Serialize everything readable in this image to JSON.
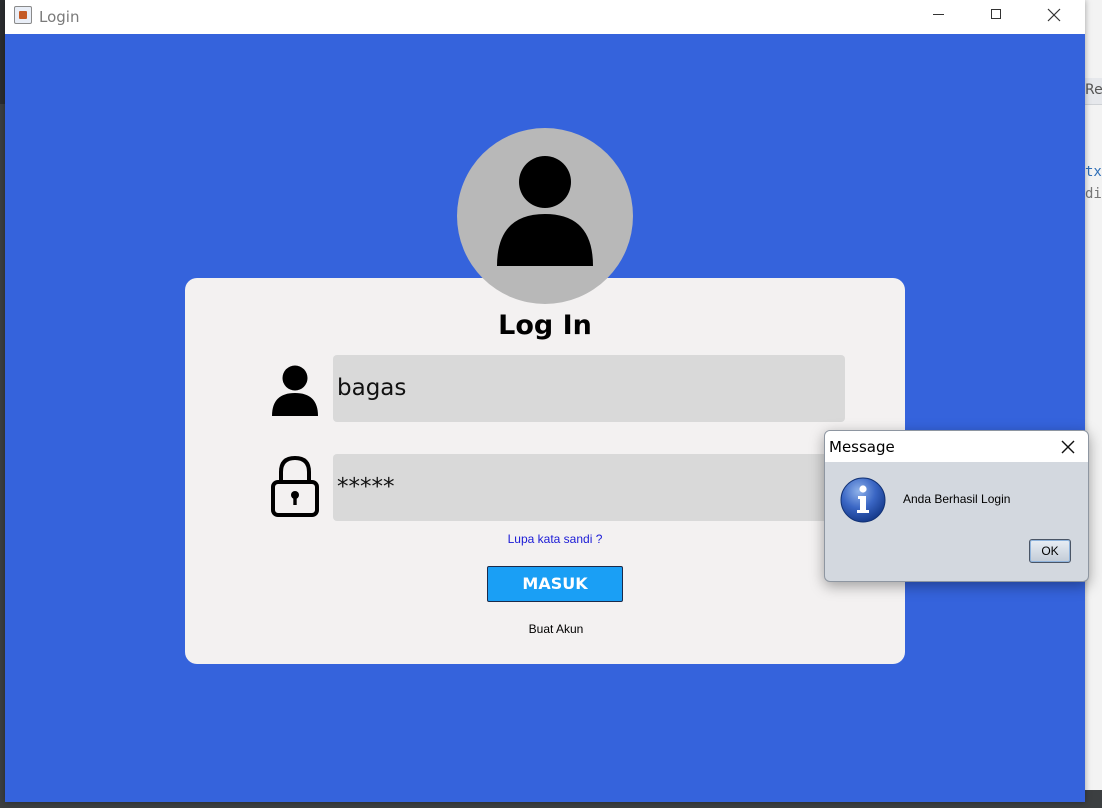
{
  "window": {
    "title": "Login",
    "background_color": "#3563dc",
    "controls": [
      "minimize-icon",
      "maximize-icon",
      "close-icon"
    ]
  },
  "login_card": {
    "heading": "Log In",
    "username_value": "bagas",
    "password_value": "*****",
    "forgot_password_link": "Lupa kata sandi ?",
    "submit_button": "MASUK",
    "create_account_link": "Buat Akun",
    "card_color": "#f3f1f1",
    "field_color": "#d9d9d9",
    "button_color": "#1a9ff5",
    "link_color": "#1a1ad6",
    "avatar_icon": "user-icon",
    "username_icon": "user-icon",
    "password_icon": "lock-icon"
  },
  "message_dialog": {
    "title": "Message",
    "message": "Anda Berhasil Login",
    "ok_label": "OK",
    "icon": "info-icon"
  },
  "background_ide": {
    "fragment_1": "Reg",
    "fragment_2": "tx",
    "fragment_3": "di"
  }
}
